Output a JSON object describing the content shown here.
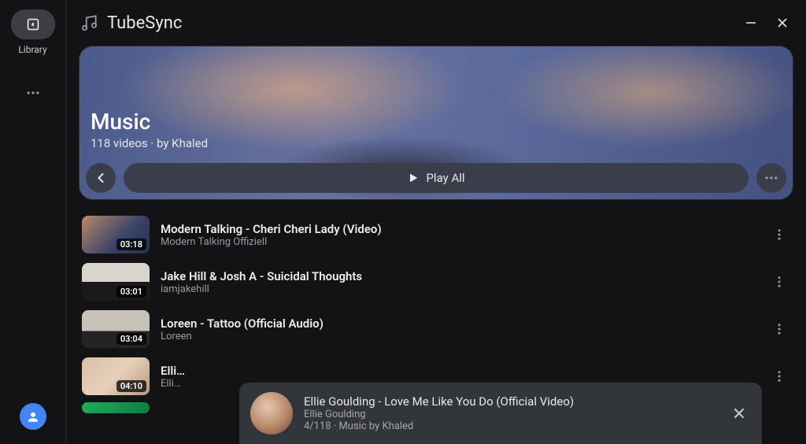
{
  "app": {
    "title": "TubeSync"
  },
  "sidebar": {
    "library_label": "Library"
  },
  "hero": {
    "title": "Music",
    "subtitle": "118 videos · by Khaled",
    "play_all": "Play All"
  },
  "videos": [
    {
      "title": "Modern Talking - Cheri Cheri Lady (Video)",
      "channel": "Modern Talking Offiziell",
      "duration": "03:18"
    },
    {
      "title": "Jake Hill & Josh A - Suicidal Thoughts",
      "channel": "iamjakehill",
      "duration": "03:01"
    },
    {
      "title": "Loreen - Tattoo (Official Audio)",
      "channel": "Loreen",
      "duration": "03:04"
    },
    {
      "title": "Elli…",
      "channel": "Elli…",
      "duration": "04:10"
    },
    {
      "title": "",
      "channel": "",
      "duration": ""
    }
  ],
  "toast": {
    "title": "Ellie Goulding - Love Me Like You Do (Official Video)",
    "artist": "Ellie Goulding",
    "meta": "4/118 · Music by Khaled"
  }
}
